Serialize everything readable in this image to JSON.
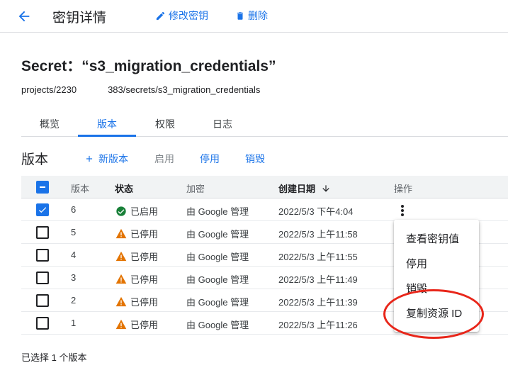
{
  "header": {
    "title": "密钥详情",
    "edit_label": "修改密钥",
    "delete_label": "删除"
  },
  "secret": {
    "title": "Secret：“s3_migration_credentials”",
    "path_prefix": "projects/2230",
    "path_suffix": "383/secrets/s3_migration_credentials"
  },
  "tabs": [
    "概览",
    "版本",
    "权限",
    "日志"
  ],
  "versions": {
    "title": "版本",
    "new_version": "新版本",
    "enable": "启用",
    "disable": "停用",
    "destroy": "销毁"
  },
  "table": {
    "columns": [
      "版本",
      "状态",
      "加密",
      "创建日期",
      "操作"
    ],
    "rows": [
      {
        "version": "6",
        "status": "已启用",
        "encryption": "由 Google 管理",
        "created": "2022/5/3 下午4:04",
        "checked": true
      },
      {
        "version": "5",
        "status": "已停用",
        "encryption": "由 Google 管理",
        "created": "2022/5/3 上午11:58",
        "checked": false
      },
      {
        "version": "4",
        "status": "已停用",
        "encryption": "由 Google 管理",
        "created": "2022/5/3 上午11:55",
        "checked": false
      },
      {
        "version": "3",
        "status": "已停用",
        "encryption": "由 Google 管理",
        "created": "2022/5/3 上午11:49",
        "checked": false
      },
      {
        "version": "2",
        "status": "已停用",
        "encryption": "由 Google 管理",
        "created": "2022/5/3 上午11:39",
        "checked": false
      },
      {
        "version": "1",
        "status": "已停用",
        "encryption": "由 Google 管理",
        "created": "2022/5/3 上午11:26",
        "checked": false
      }
    ]
  },
  "menu": {
    "items": [
      "查看密钥值",
      "停用",
      "销毁",
      "复制资源 ID"
    ]
  },
  "footer": {
    "selection": "已选择 1 个版本"
  },
  "colors": {
    "accent": "#1a73e8",
    "enabled": "#188038",
    "warning": "#e37400",
    "highlight": "#e8261a"
  }
}
